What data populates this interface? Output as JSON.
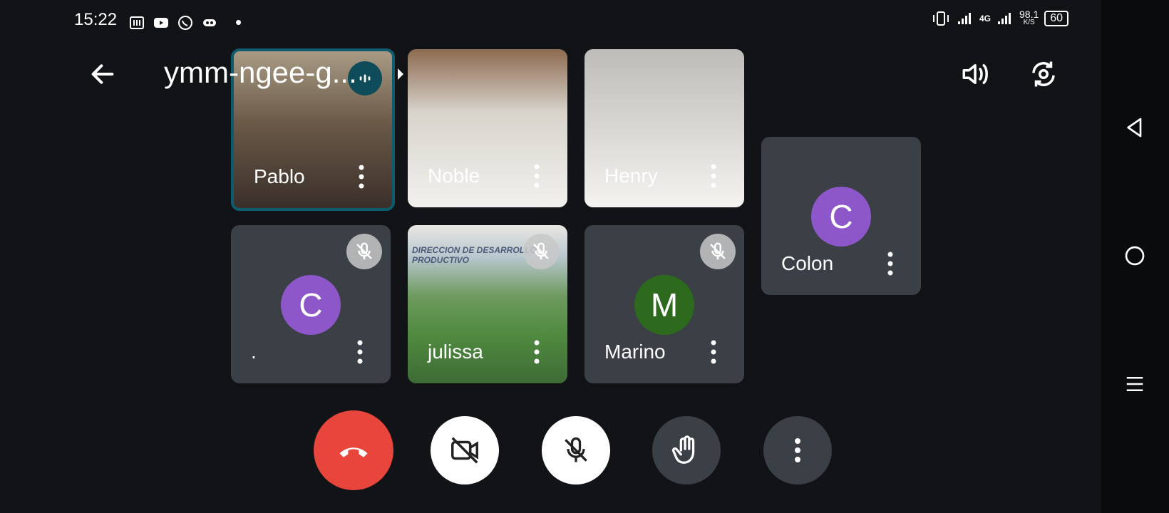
{
  "status_bar": {
    "time": "15:22",
    "network_speed": "98.1",
    "network_unit": "K/S",
    "network_type": "4G",
    "battery": "60"
  },
  "meeting": {
    "title": "ymm-ngee-g..."
  },
  "participants": [
    {
      "name": "Pablo",
      "type": "video",
      "active_speaker": true,
      "muted": false
    },
    {
      "name": "Noble",
      "type": "video",
      "muted": false
    },
    {
      "name": "Henry",
      "type": "video",
      "muted": false
    },
    {
      "name": "Colon",
      "type": "avatar",
      "initial": "C",
      "avatar_color": "#8e57c9",
      "muted": false
    },
    {
      "name": ".",
      "type": "avatar",
      "initial": "C",
      "avatar_color": "#8e57c9",
      "muted": true
    },
    {
      "name": "julissa",
      "type": "video",
      "muted": true,
      "background_text": "DIRECCION DE DESARROLLO PRODUCTIVO"
    },
    {
      "name": "Marino",
      "type": "avatar",
      "initial": "M",
      "avatar_color": "#2e6a1d",
      "muted": true
    }
  ],
  "colors": {
    "background": "#111316",
    "tile": "#3b3f46",
    "end_call": "#e8453c",
    "active_border": "#0f5c6e",
    "control_dark": "#3b3f46",
    "control_light": "#ffffff"
  },
  "icons": {
    "back": "arrow-left-icon",
    "speaker": "speaker-icon",
    "switch_camera": "switch-camera-icon",
    "end_call": "phone-hangup-icon",
    "camera_off": "camera-off-icon",
    "mic_off": "mic-off-icon",
    "raise_hand": "hand-icon",
    "more": "more-vert-icon"
  }
}
